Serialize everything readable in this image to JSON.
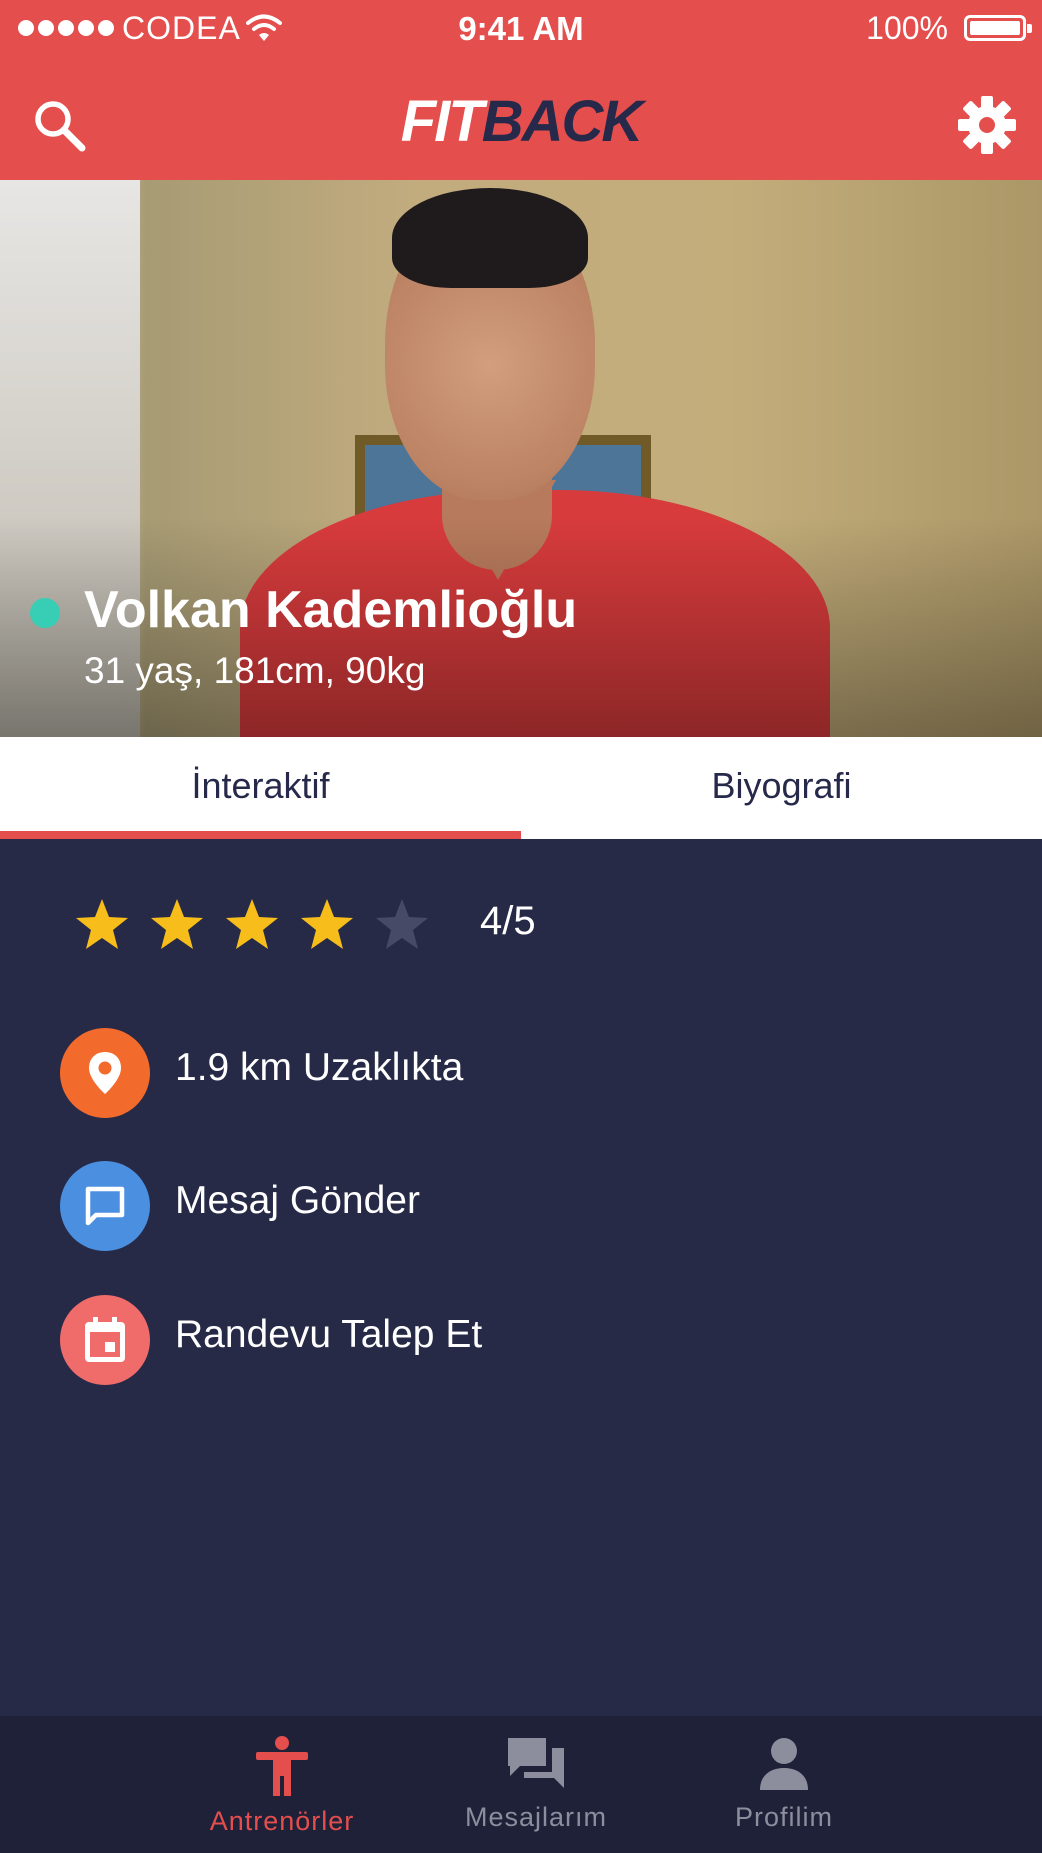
{
  "status_bar": {
    "carrier": "CODEA",
    "time": "9:41 AM",
    "battery_percent": "100%"
  },
  "header": {
    "logo_fit": "FIT",
    "logo_back": "BACK",
    "search_icon": "search-icon",
    "settings_icon": "gear-icon"
  },
  "colors": {
    "brand_red": "#e44e4d",
    "navy": "#272a47",
    "online_green": "#38cdb5",
    "star_gold": "#f7bd1b",
    "location_orange": "#f36a2d",
    "message_blue": "#4a8fe0",
    "appointment_pink": "#f06c6b"
  },
  "trainer": {
    "name": "Volkan Kademlioğlu",
    "stats": "31 yaş, 181cm, 90kg",
    "online": true
  },
  "tabs": [
    {
      "label": "İnteraktif",
      "active": true
    },
    {
      "label": "Biyografi",
      "active": false
    }
  ],
  "rating": {
    "value": 4,
    "max": 5,
    "text": "4/5"
  },
  "actions": [
    {
      "label": "1.9 km Uzaklıkta",
      "icon": "location-pin-icon"
    },
    {
      "label": "Mesaj Gönder",
      "icon": "message-icon"
    },
    {
      "label": "Randevu Talep Et",
      "icon": "calendar-icon"
    }
  ],
  "bottom_nav": [
    {
      "label": "Antrenörler",
      "icon": "trainer-icon",
      "active": true
    },
    {
      "label": "Mesajlarım",
      "icon": "chat-icon",
      "active": false
    },
    {
      "label": "Profilim",
      "icon": "person-icon",
      "active": false
    }
  ]
}
